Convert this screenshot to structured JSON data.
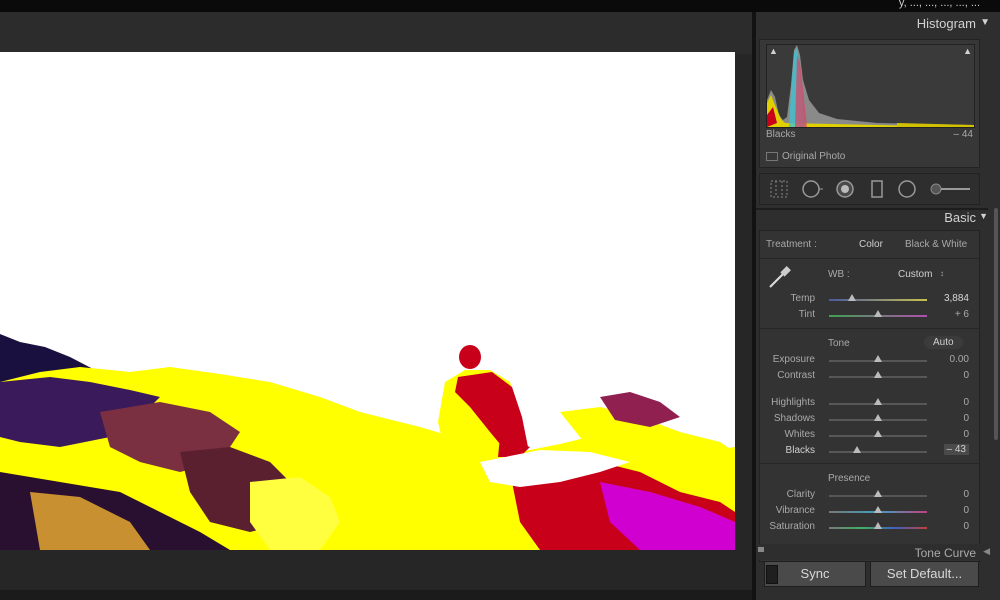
{
  "topbar": {
    "text": "y, ..., ..., ..., ..., ..."
  },
  "histogram": {
    "title": "Histogram",
    "readout_label": "Blacks",
    "readout_value": "– 44",
    "original_photo": "Original Photo"
  },
  "tools": [
    "crop-overlay-icon",
    "spot-removal-icon",
    "red-eye-icon",
    "graduated-filter-icon",
    "radial-filter-icon",
    "adjustment-brush-icon"
  ],
  "basic": {
    "title": "Basic",
    "treatment_label": "Treatment :",
    "treatment_color": "Color",
    "treatment_bw": "Black & White",
    "wb_label": "WB :",
    "wb_value": "Custom",
    "wb_arrow": "↕",
    "temp_label": "Temp",
    "temp_value": "3,884",
    "tint_label": "Tint",
    "tint_value": "+ 6",
    "tone_label": "Tone",
    "auto_label": "Auto",
    "exposure_label": "Exposure",
    "exposure_value": "0.00",
    "contrast_label": "Contrast",
    "contrast_value": "0",
    "highlights_label": "Highlights",
    "highlights_value": "0",
    "shadows_label": "Shadows",
    "shadows_value": "0",
    "whites_label": "Whites",
    "whites_value": "0",
    "blacks_label": "Blacks",
    "blacks_value": "– 43",
    "presence_label": "Presence",
    "clarity_label": "Clarity",
    "clarity_value": "0",
    "vibrance_label": "Vibrance",
    "vibrance_value": "0",
    "saturation_label": "Saturation",
    "saturation_value": "0"
  },
  "tone_curve": {
    "title": "Tone Curve"
  },
  "footer": {
    "sync_label": "Sync",
    "set_default_label": "Set Default..."
  },
  "colors": {
    "panel_bg": "#2e2e2e",
    "photo_highlight": "#ffff00",
    "photo_red": "#c8001a",
    "photo_magenta": "#d000d0"
  },
  "sliders": {
    "temp": 0.23,
    "tint": 0.5,
    "exposure": 0.5,
    "contrast": 0.5,
    "highlights": 0.5,
    "shadows": 0.5,
    "whites": 0.5,
    "blacks": 0.29,
    "clarity": 0.5,
    "vibrance": 0.5,
    "saturation": 0.5
  }
}
